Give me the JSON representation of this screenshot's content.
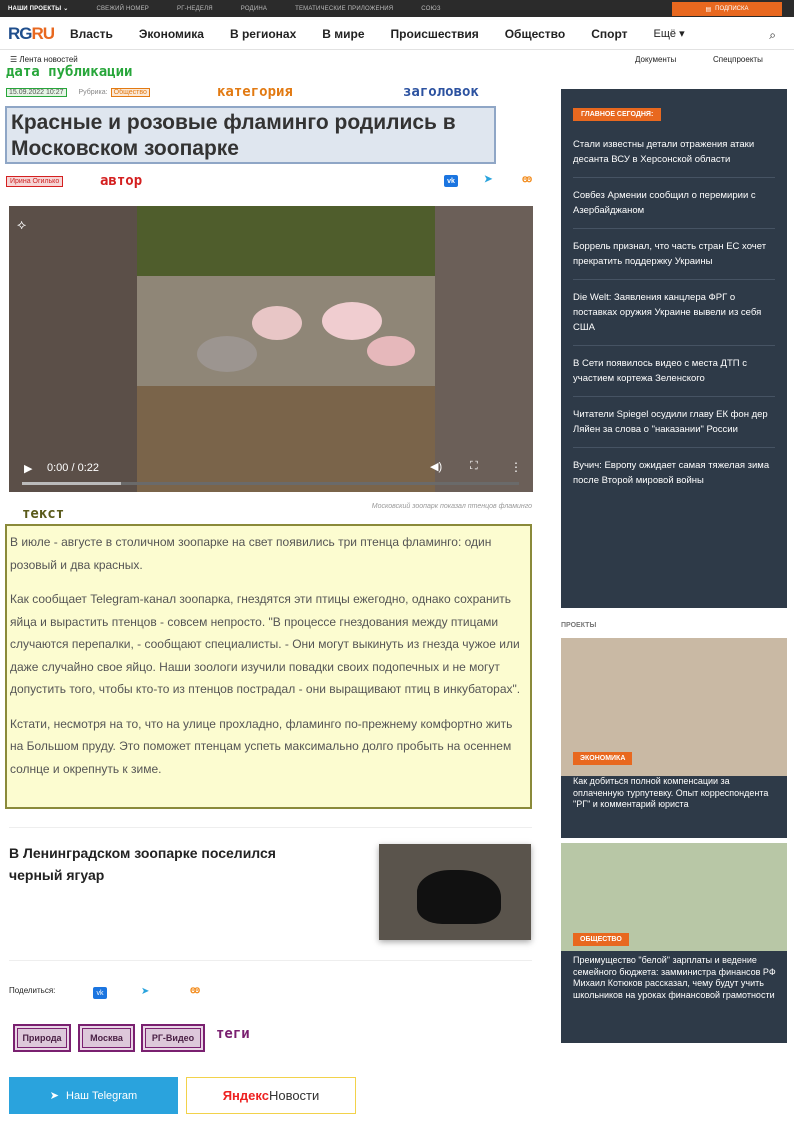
{
  "topbar": {
    "items": [
      "НАШИ ПРОЕКТЫ ⌄",
      "СВЕЖИЙ НОМЕР",
      "РГ-НЕДЕЛЯ",
      "РОДИНА",
      "ТЕМАТИЧЕСКИЕ ПРИЛОЖЕНИЯ",
      "СОЮЗ"
    ],
    "subscribe": "ПОДПИСКА"
  },
  "logo": {
    "rg": "RG",
    "ru": "RU"
  },
  "nav": {
    "items": [
      "Власть",
      "Экономика",
      "В регионах",
      "В мире",
      "Происшествия",
      "Общество",
      "Спорт",
      "Ещё ▾"
    ]
  },
  "subnav": {
    "feed": "Лента новостей",
    "docs": "Документы",
    "spec": "Спецпроекты"
  },
  "annotations": {
    "date": "дата публикации",
    "category": "категория",
    "headline": "заголовок",
    "author": "автор",
    "text": "текст",
    "tags": "теги"
  },
  "article": {
    "date": "15.09.2022 10:27",
    "rubric_label": "Рубрика:",
    "rubric": "Общество",
    "title": "Красные и розовые фламинго родились в Московском зоопарке",
    "author": "Ирина Огилько",
    "video": {
      "time": "0:00 / 0:22",
      "progress": 0.2
    },
    "caption": "Московский зоопарк показал птенцов фламинго",
    "paragraphs": [
      "В июле - августе в столичном зоопарке на свет появились три птенца фламинго: один розовый и два красных.",
      "Как сообщает Telegram-канал зоопарка, гнездятся эти птицы ежегодно, однако сохранить яйца и вырастить птенцов - совсем непросто. \"В процессе гнездования между птицами случаются перепалки, - сообщают специалисты. - Они могут выкинуть из гнезда чужое или даже случайно свое яйцо. Наши зоологи изучили повадки своих подопечных и не могут допустить того, чтобы кто-то из птенцов пострадал - они выращивают птиц в инкубаторах\".",
      "Кстати, несмотря на то, что на улице прохладно, фламинго по-прежнему комфортно жить на Большом пруду. Это поможет птенцам успеть максимально долго пробыть на осеннем солнце и окрепнуть к зиме."
    ],
    "related_title": "В Ленинградском зоопарке поселился черный ягуар",
    "share_label": "Поделиться:",
    "tags": [
      "Природа",
      "Москва",
      "РГ-Видео"
    ]
  },
  "buttons": {
    "telegram": "Наш Telegram",
    "yandex_1": "Яндекс",
    "yandex_2": "Новости"
  },
  "sidebar": {
    "header": "ГЛАВНОЕ СЕГОДНЯ:",
    "items": [
      "Стали известны детали отражения атаки десанта ВСУ в Херсонской области",
      "Совбез Армении сообщил о перемирии с Азербайджаном",
      "Боррель признал, что часть стран ЕС хочет прекратить поддержку Украины",
      "Die Welt: Заявления канцлера ФРГ о поставках оружия Украине вывели из себя США",
      "В Сети появилось видео с места ДТП с участием кортежа Зеленского",
      "Читатели Spiegel осудили главу ЕК фон дер Ляйен за слова о \"наказании\" России",
      "Вучич: Европу ожидает самая тяжелая зима после Второй мировой войны"
    ],
    "projects_label": "ПРОЕКТЫ",
    "cards": [
      {
        "category": "ЭКОНОМИКА",
        "title": "Как добиться полной компенсации за оплаченную турпутевку. Опыт корреспондента \"РГ\" и комментарий юриста"
      },
      {
        "category": "ОБЩЕСТВО",
        "title": "Преимущество \"белой\" зарплаты и ведение семейного бюджета: замминистра финансов РФ Михаил Котюков рассказал, чему будут учить школьников на уроках финансовой грамотности"
      }
    ]
  },
  "colors": {
    "accent": "#e8681f",
    "sidebar_bg": "#2e3a48",
    "telegram": "#2aa3dd",
    "vk": "#1b75e0"
  }
}
